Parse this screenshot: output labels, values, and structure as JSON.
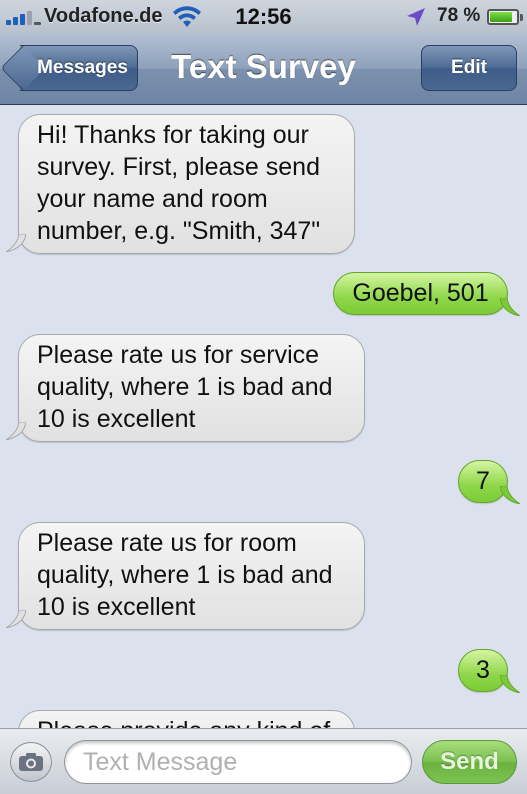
{
  "status_bar": {
    "carrier": "Vodafone.de",
    "time": "12:56",
    "battery_percent": "78 %",
    "battery_level": 0.78,
    "icons": [
      "signal-icon",
      "wifi-icon",
      "location-arrow-icon",
      "battery-icon"
    ]
  },
  "nav": {
    "back_label": "Messages",
    "title": "Text Survey",
    "edit_label": "Edit"
  },
  "messages": [
    {
      "direction": "in",
      "text": "Hi! Thanks for taking our survey. First, please send your name and room number, e.g. \"Smith, 347\""
    },
    {
      "direction": "out",
      "text": "Goebel, 501"
    },
    {
      "direction": "in",
      "text": "Please rate us for service quality, where 1 is bad and 10 is excellent"
    },
    {
      "direction": "out",
      "text": "7"
    },
    {
      "direction": "in",
      "text": "Please rate us for room quality, where 1 is bad and 10 is excellent"
    },
    {
      "direction": "out",
      "text": "3"
    },
    {
      "direction": "in",
      "text": "Please provide any kind of"
    }
  ],
  "input": {
    "placeholder": "Text Message",
    "value": "",
    "send_label": "Send"
  },
  "colors": {
    "incoming_bubble": "#e6e6e6",
    "outgoing_bubble": "#8fd74a",
    "background": "#dbe2ed",
    "nav_bar": "#7c91ad"
  }
}
